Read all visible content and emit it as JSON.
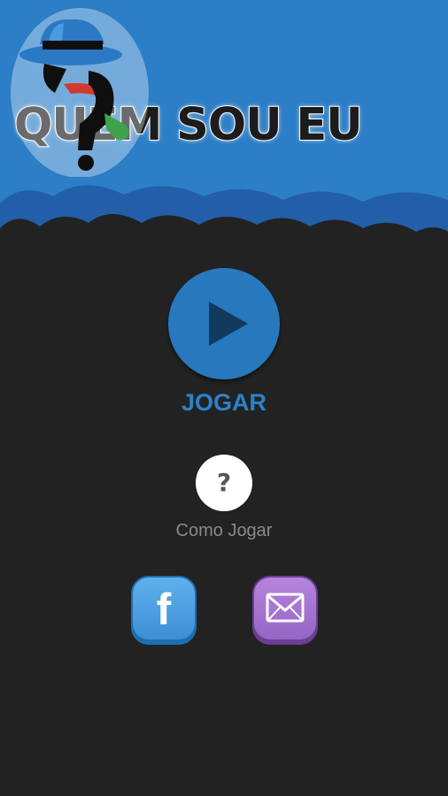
{
  "game": {
    "title": "QUEM SOU EU",
    "play_label": "JOGAR",
    "help_glyph": "?",
    "help_label": "Como Jogar"
  },
  "icons": {
    "play": "play-icon",
    "help": "question-icon",
    "facebook": "facebook-icon",
    "facebook_glyph": "f",
    "mail": "mail-icon",
    "mascot": "detective-hat-question-mark"
  },
  "colors": {
    "background": "#222223",
    "header_blue": "#2c7ec6",
    "accent_blue": "#2878be",
    "facebook": "#4a9ee0",
    "mail": "#a475d2"
  }
}
